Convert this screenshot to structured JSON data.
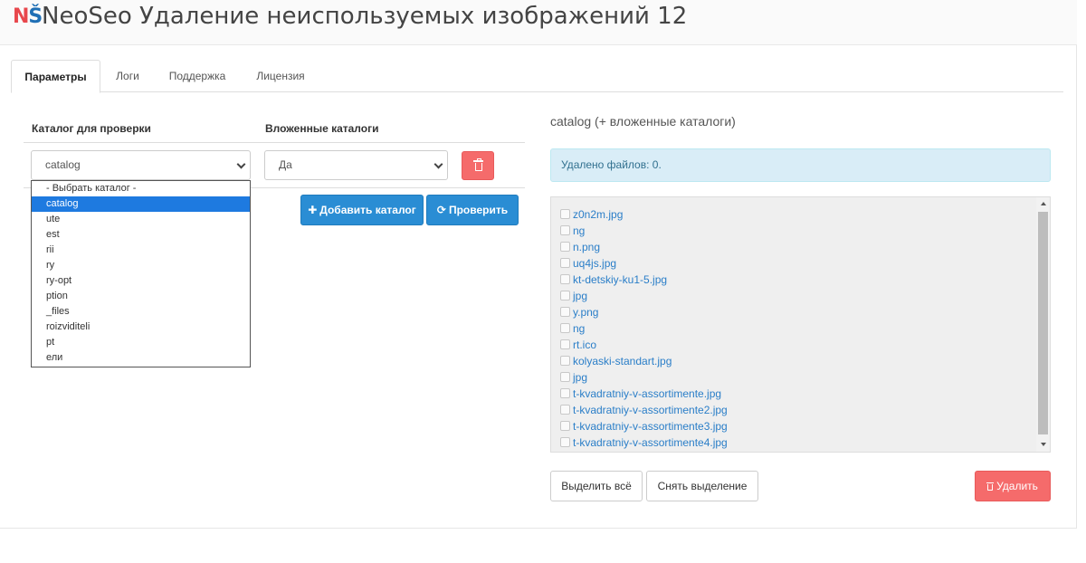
{
  "header": {
    "logo_n": "N",
    "logo_s": "Š",
    "title": "NeoSeo Удаление неиспользуемых изображений 12"
  },
  "tabs": [
    {
      "label": "Параметры",
      "active": true
    },
    {
      "label": "Логи",
      "active": false
    },
    {
      "label": "Поддержка",
      "active": false
    },
    {
      "label": "Лицензия",
      "active": false
    }
  ],
  "table": {
    "col1_header": "Каталог для проверки",
    "col2_header": "Вложенные каталоги",
    "catalog_select_value": "catalog",
    "nested_select_value": "Да"
  },
  "buttons": {
    "add_catalog": "Добавить каталог",
    "add_catalog_icon": "plus-icon",
    "check": "Проверить",
    "check_icon": "refresh-icon",
    "select_all": "Выделить всё",
    "deselect": "Снять выделение",
    "delete": "Удалить",
    "delete_icon": "trash-icon"
  },
  "dropdown": {
    "options": [
      "- Выбрать каталог -",
      "catalog",
      "ute",
      "est",
      "rii",
      "ry",
      "ry-opt",
      "ption",
      "_files",
      "roizviditeli",
      "pt",
      "ели"
    ],
    "selected_index": 1
  },
  "results": {
    "title": "catalog (+ вложенные каталоги)",
    "alert": "Удалено файлов: 0.",
    "files": [
      "z0n2m.jpg",
      "ng",
      "n.png",
      "uq4js.jpg",
      "kt-detskiy-ku1-5.jpg",
      "jpg",
      "y.png",
      "ng",
      "rt.ico",
      "kolyaski-standart.jpg",
      "jpg",
      "t-kvadratniy-v-assortimente.jpg",
      "t-kvadratniy-v-assortimente2.jpg",
      "t-kvadratniy-v-assortimente3.jpg",
      "t-kvadratniy-v-assortimente4.jpg"
    ]
  },
  "colors": {
    "primary": "#2a8dd4",
    "danger": "#f56b6b",
    "info_bg": "#d9edf7",
    "link": "#2a7ec8",
    "selected_option": "#1e7ae0"
  }
}
